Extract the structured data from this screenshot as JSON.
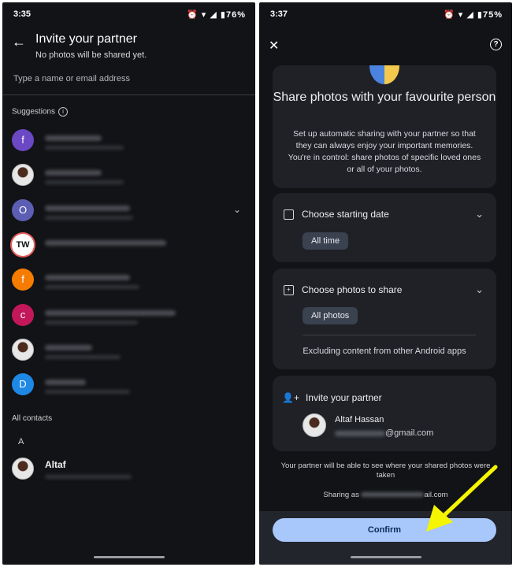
{
  "left_screen": {
    "status": {
      "time": "3:35",
      "battery": "76%"
    },
    "header": {
      "title": "Invite your partner",
      "subtitle": "No photos will be shared yet."
    },
    "search": {
      "placeholder": "Type a name or email address"
    },
    "suggestions_heading": "Suggestions",
    "suggestions": [
      {
        "initial": "f",
        "color": "#6b48c4"
      },
      {
        "initial": "",
        "color": "#e7e7e7"
      },
      {
        "initial": "O",
        "color": "#5b5eb3"
      },
      {
        "initial": "TW",
        "color": "#ffffff"
      },
      {
        "initial": "f",
        "color": "#f57c00"
      },
      {
        "initial": "c",
        "color": "#c2185b"
      },
      {
        "initial": "",
        "color": "#e7e7e7"
      },
      {
        "initial": "D",
        "color": "#1e88e5"
      }
    ],
    "all_contacts_heading": "All contacts",
    "section_letter": "A",
    "contact": {
      "name": "Altaf"
    }
  },
  "right_screen": {
    "status": {
      "time": "3:37",
      "battery": "75%"
    },
    "hero": {
      "title": "Share photos with your favourite person",
      "description": "Set up automatic sharing with your partner so that they can always enjoy your important memories. You're in control: share photos of specific loved ones or all of your photos."
    },
    "starting_date": {
      "title": "Choose starting date",
      "chip": "All time"
    },
    "photos_to_share": {
      "title": "Choose photos to share",
      "chip": "All photos",
      "note": "Excluding content from other Android apps"
    },
    "invite": {
      "title": "Invite your partner",
      "name": "Altaf Hassan",
      "email_suffix": "@gmail.com"
    },
    "footer_note": "Your partner will be able to see where your shared photos were taken",
    "sharing_prefix": "Sharing as",
    "sharing_suffix": "ail.com",
    "confirm_label": "Confirm",
    "accent_color": "#a8c7fa",
    "annotation_arrow_color": "#f5f500"
  }
}
